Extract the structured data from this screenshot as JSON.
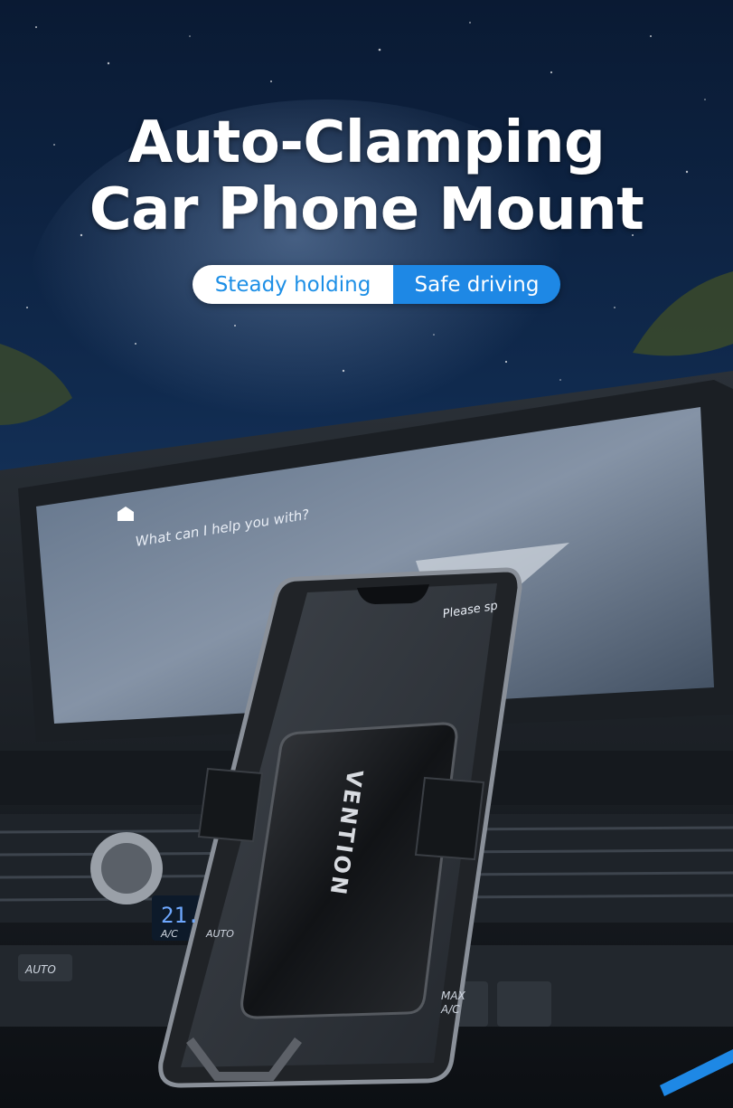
{
  "headline": {
    "line1": "Auto-Clamping",
    "line2": "Car Phone Mount"
  },
  "badges": {
    "left": "Steady holding",
    "right": "Safe driving"
  },
  "scene": {
    "screen_prompt": "What can I help you with?",
    "screen_hint": "Please sp",
    "brand": "VENTION",
    "climate_temp": "21.",
    "climate_ac": "A/C",
    "climate_auto": "AUTO",
    "button_auto": "AUTO",
    "button_max_ac_line1": "MAX",
    "button_max_ac_line2": "A/C"
  },
  "colors": {
    "accent_blue": "#1e88e5",
    "sky_dark": "#06101f",
    "headline_text": "#ffffff"
  }
}
